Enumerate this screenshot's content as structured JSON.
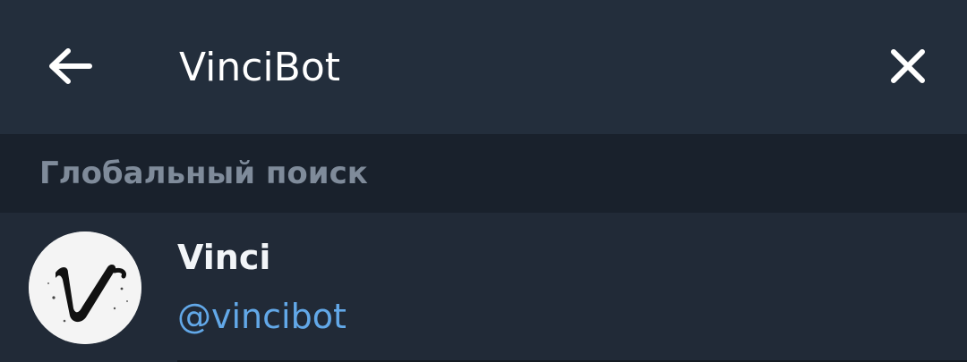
{
  "topbar": {
    "back_icon": "arrow-left-icon",
    "search_value": "VinciBot",
    "clear_icon": "close-icon"
  },
  "section": {
    "title": "Глобальный поиск"
  },
  "results": [
    {
      "name": "Vinci",
      "username": "@vincibot",
      "avatar_icon": "vinci-logo"
    }
  ],
  "colors": {
    "topbar_bg": "#232e3c",
    "section_bg": "#19212c",
    "list_bg": "#212a37",
    "username": "#62a8e8",
    "section_text": "#7f8b9a"
  }
}
